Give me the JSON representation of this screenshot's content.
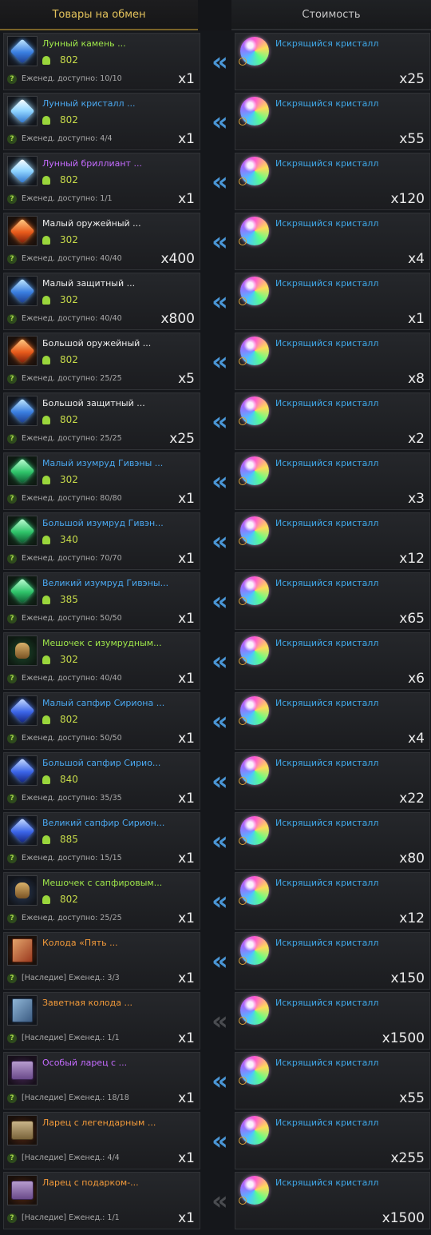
{
  "header": {
    "items_label": "Товары на обмен",
    "cost_label": "Стоимость"
  },
  "colors": {
    "green": "#9fe84a",
    "blue": "#4aa8f0",
    "purple": "#c46bff",
    "white": "#f0f0f0",
    "orange": "#f29a3a",
    "arrow_active": "#4a96d6",
    "arrow_inactive": "#4a4c50"
  },
  "rows": [
    {
      "name": "Лунный камень ...",
      "name_color": "green",
      "icon": "moonstone-icon",
      "score": "802",
      "note": "Еженед. доступно: 10/10",
      "qty": "x1",
      "cost_name": "Искрящийся кристалл",
      "cost_qty": "x25",
      "active": true
    },
    {
      "name": "Лунный кристалл ...",
      "name_color": "blue",
      "icon": "moon-crystal-icon",
      "score": "802",
      "note": "Еженед. доступно: 4/4",
      "qty": "x1",
      "cost_name": "Искрящийся кристалл",
      "cost_qty": "x55",
      "active": true
    },
    {
      "name": "Лунный бриллиант ...",
      "name_color": "purple",
      "icon": "moon-diamond-icon",
      "score": "802",
      "note": "Еженед. доступно: 1/1",
      "qty": "x1",
      "cost_name": "Искрящийся кристалл",
      "cost_qty": "x120",
      "active": true
    },
    {
      "name": "Малый оружейный ...",
      "name_color": "white",
      "icon": "weapon-stone-icon",
      "score": "302",
      "note": "Еженед. доступно: 40/40",
      "qty": "x400",
      "cost_name": "Искрящийся кристалл",
      "cost_qty": "x4",
      "active": true
    },
    {
      "name": "Малый защитный ...",
      "name_color": "white",
      "icon": "armor-stone-icon",
      "score": "302",
      "note": "Еженед. доступно: 40/40",
      "qty": "x800",
      "cost_name": "Искрящийся кристалл",
      "cost_qty": "x1",
      "active": true
    },
    {
      "name": "Большой оружейный ...",
      "name_color": "white",
      "icon": "weapon-stone-large-icon",
      "score": "802",
      "note": "Еженед. доступно: 25/25",
      "qty": "x5",
      "cost_name": "Искрящийся кристалл",
      "cost_qty": "x8",
      "active": true
    },
    {
      "name": "Большой защитный ...",
      "name_color": "white",
      "icon": "armor-stone-large-icon",
      "score": "802",
      "note": "Еженед. доступно: 25/25",
      "qty": "x25",
      "cost_name": "Искрящийся кристалл",
      "cost_qty": "x2",
      "active": true
    },
    {
      "name": "Малый изумруд Гивэны ...",
      "name_color": "blue",
      "icon": "emerald-small-icon",
      "score": "302",
      "note": "Еженед. доступно: 80/80",
      "qty": "x1",
      "cost_name": "Искрящийся кристалл",
      "cost_qty": "x3",
      "active": true
    },
    {
      "name": "Большой изумруд Гивэн...",
      "name_color": "blue",
      "icon": "emerald-large-icon",
      "score": "340",
      "note": "Еженед. доступно: 70/70",
      "qty": "x1",
      "cost_name": "Искрящийся кристалл",
      "cost_qty": "x12",
      "active": true
    },
    {
      "name": "Великий изумруд Гивэны...",
      "name_color": "blue",
      "icon": "emerald-great-icon",
      "score": "385",
      "note": "Еженед. доступно: 50/50",
      "qty": "x1",
      "cost_name": "Искрящийся кристалл",
      "cost_qty": "x65",
      "active": true
    },
    {
      "name": "Мешочек с изумрудным...",
      "name_color": "green",
      "icon": "emerald-pouch-icon",
      "score": "302",
      "note": "Еженед. доступно: 40/40",
      "qty": "x1",
      "cost_name": "Искрящийся кристалл",
      "cost_qty": "x6",
      "active": true
    },
    {
      "name": "Малый сапфир Сириона ...",
      "name_color": "blue",
      "icon": "sapphire-small-icon",
      "score": "802",
      "note": "Еженед. доступно: 50/50",
      "qty": "x1",
      "cost_name": "Искрящийся кристалл",
      "cost_qty": "x4",
      "active": true
    },
    {
      "name": "Большой сапфир Сирио...",
      "name_color": "blue",
      "icon": "sapphire-large-icon",
      "score": "840",
      "note": "Еженед. доступно: 35/35",
      "qty": "x1",
      "cost_name": "Искрящийся кристалл",
      "cost_qty": "x22",
      "active": true
    },
    {
      "name": "Великий сапфир Сирион...",
      "name_color": "blue",
      "icon": "sapphire-great-icon",
      "score": "885",
      "note": "Еженед. доступно: 15/15",
      "qty": "x1",
      "cost_name": "Искрящийся кристалл",
      "cost_qty": "x80",
      "active": true
    },
    {
      "name": "Мешочек с сапфировым...",
      "name_color": "green",
      "icon": "sapphire-pouch-icon",
      "score": "802",
      "note": "Еженед. доступно: 25/25",
      "qty": "x1",
      "cost_name": "Искрящийся кристалл",
      "cost_qty": "x12",
      "active": true
    },
    {
      "name": "Колода «Пять ...",
      "name_color": "orange",
      "icon": "card-deck-icon",
      "score": "",
      "note": "[Наследие] Еженед.: 3/3",
      "qty": "x1",
      "cost_name": "Искрящийся кристалл",
      "cost_qty": "x150",
      "active": true
    },
    {
      "name": "Заветная колода ...",
      "name_color": "orange",
      "icon": "cherished-deck-icon",
      "score": "",
      "note": "[Наследие] Еженед.: 1/1",
      "qty": "x1",
      "cost_name": "Искрящийся кристалл",
      "cost_qty": "x1500",
      "active": false
    },
    {
      "name": "Особый ларец с ...",
      "name_color": "purple",
      "icon": "special-chest-icon",
      "score": "",
      "note": "[Наследие] Еженед.: 18/18",
      "qty": "x1",
      "cost_name": "Искрящийся кристалл",
      "cost_qty": "x55",
      "active": true
    },
    {
      "name": "Ларец с легендарным ...",
      "name_color": "orange",
      "icon": "legendary-chest-icon",
      "score": "",
      "note": "[Наследие] Еженед.: 4/4",
      "qty": "x1",
      "cost_name": "Искрящийся кристалл",
      "cost_qty": "x255",
      "active": true
    },
    {
      "name": "Ларец с подарком-...",
      "name_color": "orange",
      "icon": "gift-chest-icon",
      "score": "",
      "note": "[Наследие] Еженед.: 1/1",
      "qty": "x1",
      "cost_name": "Искрящийся кристалл",
      "cost_qty": "x1500",
      "active": false
    }
  ]
}
